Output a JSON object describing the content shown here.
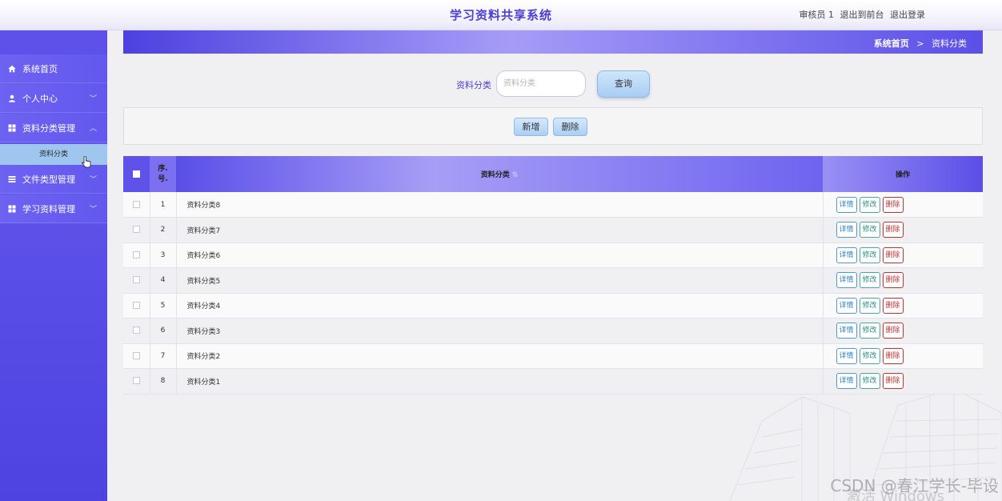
{
  "header": {
    "title": "学习资料共享系统",
    "user_role": "审核员 1",
    "to_front_label": "退出到前台",
    "logout_label": "退出登录"
  },
  "sidebar": {
    "items": [
      {
        "label": "系统首页",
        "icon": "home-icon",
        "has_chevron": false
      },
      {
        "label": "个人中心",
        "icon": "user-icon",
        "has_chevron": true
      },
      {
        "label": "资料分类管理",
        "icon": "grid-icon",
        "has_chevron": true,
        "expanded": true
      },
      {
        "label": "文件类型管理",
        "icon": "list-icon",
        "has_chevron": true
      },
      {
        "label": "学习资料管理",
        "icon": "grid-icon",
        "has_chevron": true
      }
    ],
    "sub_item": "资料分类"
  },
  "breadcrumb": {
    "home": "系统首页",
    "separator": ">",
    "current": "资料分类"
  },
  "search": {
    "label": "资料分类",
    "placeholder": "资料分类",
    "button_label": "查询"
  },
  "actions": {
    "add_label": "新增",
    "delete_label": "删除"
  },
  "table": {
    "headers": {
      "index": "序号",
      "index_line1": "序.",
      "index_line2": "号.",
      "name": "资料分类",
      "operations": "操作"
    },
    "op_labels": {
      "detail": "详情",
      "edit": "修改",
      "delete": "删除"
    },
    "rows": [
      {
        "index": "1",
        "name": "资料分类8"
      },
      {
        "index": "2",
        "name": "资料分类7"
      },
      {
        "index": "3",
        "name": "资料分类6"
      },
      {
        "index": "4",
        "name": "资料分类5"
      },
      {
        "index": "5",
        "name": "资料分类4"
      },
      {
        "index": "6",
        "name": "资料分类3"
      },
      {
        "index": "7",
        "name": "资料分类2"
      },
      {
        "index": "8",
        "name": "资料分类1"
      }
    ]
  },
  "overlay": {
    "watermark": "CSDN @春江学长-毕设",
    "activate": "激活 Windows"
  },
  "colors": {
    "accent": "#4b3fd4",
    "sidebar": "#5a4ee8",
    "sub_item_bg": "#9ec6ee",
    "delete": "#c43131",
    "detail": "#2d7fc0",
    "edit": "#2b8a8a"
  }
}
